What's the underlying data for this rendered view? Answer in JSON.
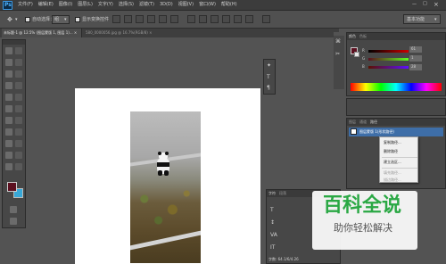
{
  "menubar": {
    "logo": "Ps",
    "items": [
      "文件(F)",
      "编辑(E)",
      "图像(I)",
      "图层(L)",
      "文字(Y)",
      "选择(S)",
      "滤镜(T)",
      "3D(D)",
      "视图(V)",
      "窗口(W)",
      "帮助(H)"
    ]
  },
  "options": {
    "auto_select": "自动选择：",
    "auto_select_value": "组",
    "show_transform": "显示变换控件",
    "workspace": "基本功能"
  },
  "tabs": [
    {
      "label": "未标题-1 @ 12.5% (图层蒙版 1, 图层 1)... ×",
      "active": true
    },
    {
      "label": "580_0000056.jpg @ 16.7%(RGB/8) ×",
      "active": false
    }
  ],
  "color_panel": {
    "tabs": [
      "颜色",
      "色板"
    ],
    "r_value": "61",
    "g_value": "1",
    "b_value": "28"
  },
  "paths_panel": {
    "tabs": [
      "图层",
      "通道",
      "路径"
    ],
    "item_label": "图层蒙版 1(形状路径)"
  },
  "context_menu": {
    "items": [
      "复制路径...",
      "删除路径",
      "建立选区...",
      "填充路径...",
      "描边路径..."
    ]
  },
  "props_panel": {
    "tabs": [
      "字符",
      "段落"
    ],
    "footer": "字数: 64.1/6/4.26"
  },
  "watermark": {
    "title": "百科全说",
    "subtitle": "助你轻松解决"
  },
  "colors": {
    "foreground": "#5c1020",
    "background": "#38a8d8",
    "accent": "#3e6ea8"
  }
}
